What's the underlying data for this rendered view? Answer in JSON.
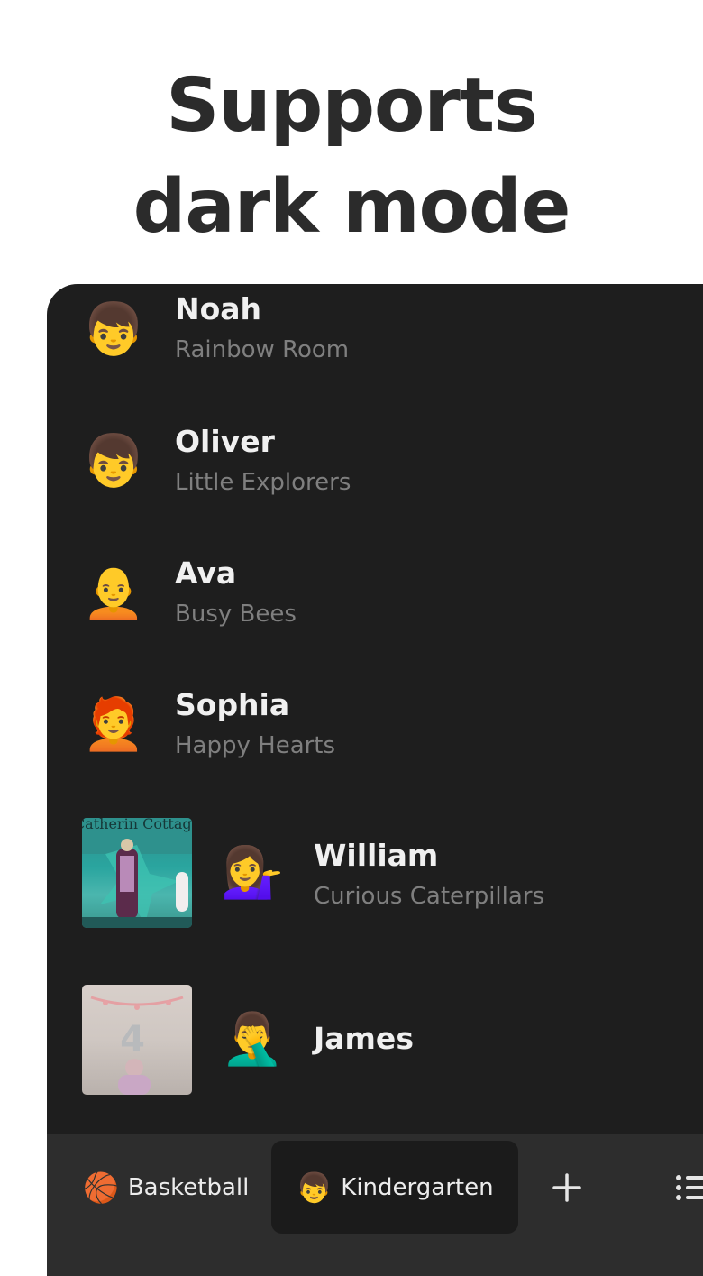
{
  "headline": {
    "line1": "Supports",
    "line2": "dark mode"
  },
  "children": [
    {
      "emoji": "👦",
      "name": "Noah",
      "group": "Rainbow Room"
    },
    {
      "emoji": "👦",
      "name": "Oliver",
      "group": "Little Explorers"
    },
    {
      "emoji": "🧑‍🦲",
      "name": "Ava",
      "group": "Busy Bees"
    },
    {
      "emoji": "🧑‍🦰",
      "name": "Sophia",
      "group": "Happy Hearts"
    },
    {
      "emoji": "💁‍♀️",
      "name": "William",
      "group": "Curious Caterpillars",
      "photo_text": "Catherin Cottage"
    },
    {
      "emoji": "🤦‍♂️",
      "name": "James",
      "group": "",
      "photo_text": "4"
    }
  ],
  "tabs": [
    {
      "emoji": "🏀",
      "label": "Basketball",
      "active": false
    },
    {
      "emoji": "👦",
      "label": "Kindergarten",
      "active": true
    }
  ],
  "icons": {
    "add": "plus-icon",
    "list": "list-icon"
  }
}
